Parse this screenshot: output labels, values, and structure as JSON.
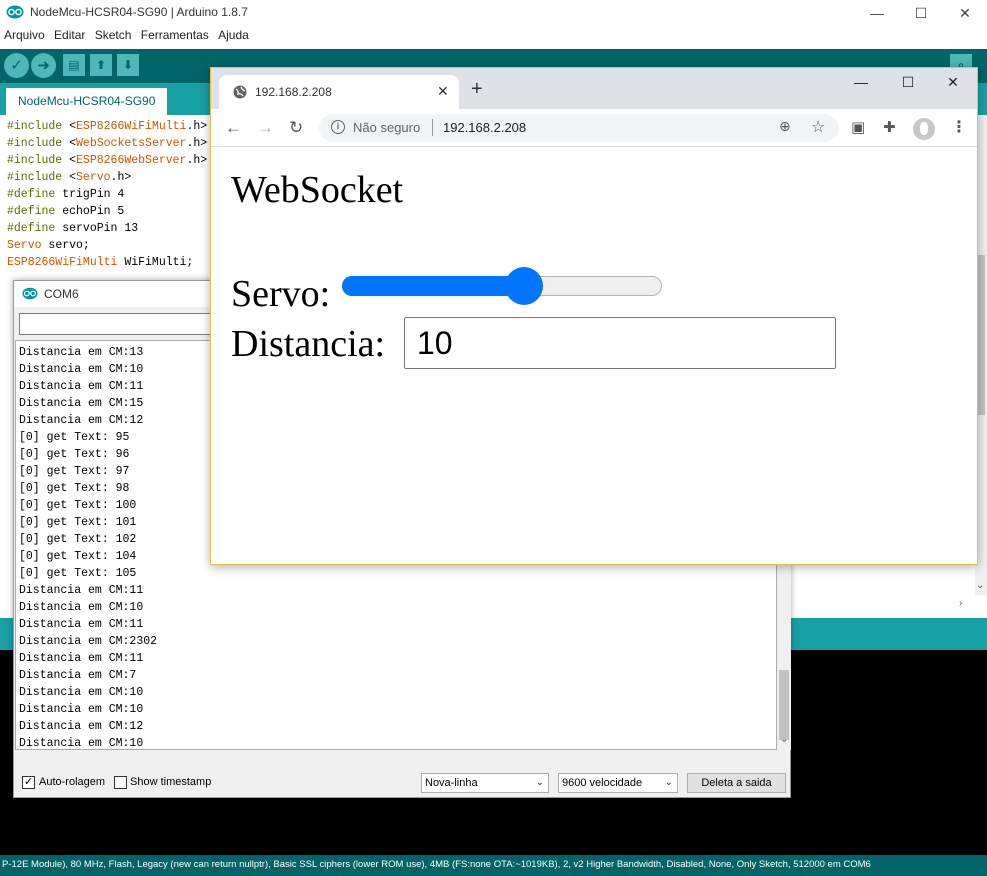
{
  "arduino": {
    "title": "NodeMcu-HCSR04-SG90 | Arduino 1.8.7",
    "menu": [
      "Arquivo",
      "Editar",
      "Sketch",
      "Ferramentas",
      "Ajuda"
    ],
    "tab_label": "NodeMcu-HCSR04-SG90",
    "code_lines": [
      [
        "#include <",
        "ESP8266WiFiMulti",
        ".h>"
      ],
      [
        "#include <",
        "WebSocketsServer",
        ".h>"
      ],
      [
        "#include <",
        "ESP8266WebServer",
        ".h>"
      ],
      [
        "#include <",
        "Servo",
        ".h>"
      ],
      [
        "#define",
        " trigPin 4",
        ""
      ],
      [
        "#define",
        " echoPin 5",
        ""
      ],
      [
        "#define",
        " servoPin 13",
        ""
      ],
      [
        "Servo",
        " servo;",
        ""
      ],
      [
        "ESP8266WiFiMulti",
        " WiFiMulti;",
        ""
      ]
    ],
    "status_bar": "P-12E Module), 80 MHz, Flash, Legacy (new can return nullptr), Basic SSL ciphers (lower ROM use), 4MB (FS:none OTA:~1019KB), 2, v2 Higher Bandwidth, Disabled, None, Only Sketch, 512000 em COM6"
  },
  "serial_monitor": {
    "title": "COM6",
    "send_input_value": "",
    "lines": [
      "Distancia em CM:13",
      "Distancia em CM:10",
      "Distancia em CM:11",
      "Distancia em CM:15",
      "Distancia em CM:12",
      "[0] get Text: 95",
      "[0] get Text: 96",
      "[0] get Text: 97",
      "[0] get Text: 98",
      "[0] get Text: 100",
      "[0] get Text: 101",
      "[0] get Text: 102",
      "[0] get Text: 104",
      "[0] get Text: 105",
      "Distancia em CM:11",
      "Distancia em CM:10",
      "Distancia em CM:11",
      "Distancia em CM:2302",
      "Distancia em CM:11",
      "Distancia em CM:7",
      "Distancia em CM:10",
      "Distancia em CM:10",
      "Distancia em CM:12",
      "Distancia em CM:10"
    ],
    "autoscroll_label": "Auto-rolagem",
    "autoscroll_checked": true,
    "timestamp_label": "Show timestamp",
    "timestamp_checked": false,
    "line_ending": "Nova-linha",
    "baud_rate": "9600 velocidade",
    "clear_button": "Deleta a saida"
  },
  "chrome": {
    "tab_title": "192.168.2.208",
    "security_label": "Não seguro",
    "url": "192.168.2.208",
    "page": {
      "heading": "WebSocket",
      "servo_label": "Servo:",
      "servo_value": 0.57,
      "distance_label": "Distancia:",
      "distance_value": "10"
    }
  }
}
